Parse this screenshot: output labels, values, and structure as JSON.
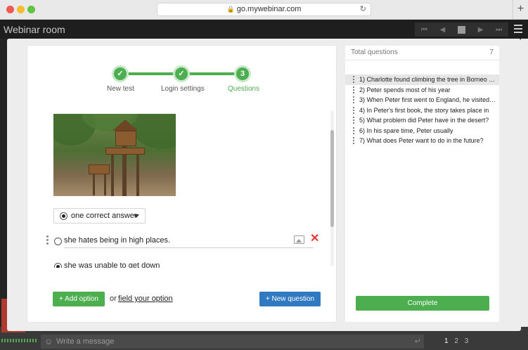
{
  "browser": {
    "url": "go.mywebinar.com",
    "new_tab": "+"
  },
  "app": {
    "title": "Webinar room"
  },
  "background": {
    "message_placeholder": "Write a message",
    "pages": [
      "1",
      "2",
      "3"
    ]
  },
  "steps": [
    {
      "label": "New test",
      "mark": "✓"
    },
    {
      "label": "Login settings",
      "mark": "✓"
    },
    {
      "label": "Questions",
      "mark": "3"
    }
  ],
  "editor": {
    "answer_mode": "one correct answer",
    "options": [
      {
        "text": "she hates being in high places.",
        "selected": false
      },
      {
        "text": "she was unable to get down",
        "selected": true
      }
    ],
    "add_option_label": "+ Add option",
    "or_label": "or",
    "field_option_label": "field your option",
    "new_question_label": "+ New question"
  },
  "questions_panel": {
    "title": "Total questions",
    "count": "7",
    "items": [
      "1) Charlotte found climbing the tree in Borneo s...",
      "2) Peter spends most of his year",
      "3) When Peter first went to England, he visited ...",
      "4) In Peter's first book, the story takes place in",
      "5) What problem did Peter have in the desert?",
      "6) In his spare time, Peter usually",
      "7) What does Peter want to do in the future?"
    ],
    "complete_label": "Complete"
  },
  "colors": {
    "accent_green": "#4cae4f",
    "accent_blue": "#2f79c1",
    "delete_red": "#e53935"
  }
}
